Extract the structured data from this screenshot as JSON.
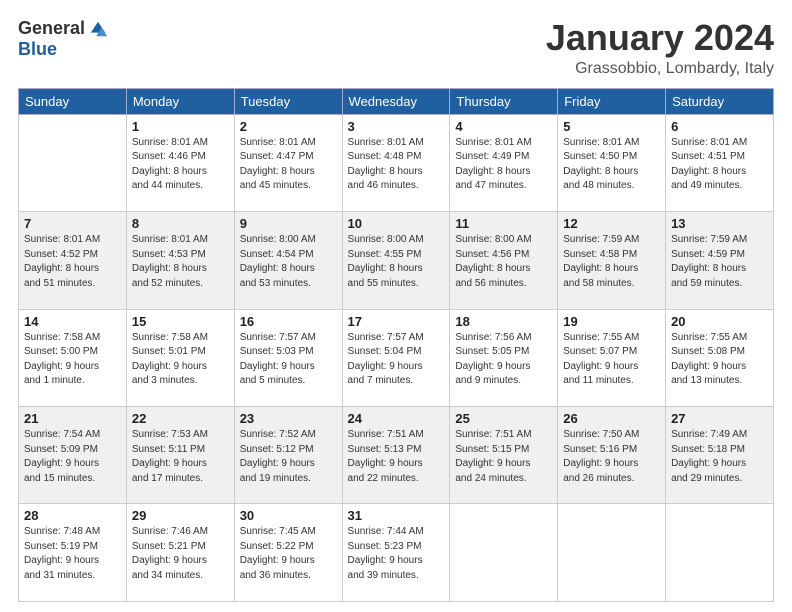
{
  "header": {
    "logo_general": "General",
    "logo_blue": "Blue",
    "month_title": "January 2024",
    "location": "Grassobbio, Lombardy, Italy"
  },
  "weekdays": [
    "Sunday",
    "Monday",
    "Tuesday",
    "Wednesday",
    "Thursday",
    "Friday",
    "Saturday"
  ],
  "weeks": [
    [
      {
        "date": "",
        "info": "",
        "shaded": false,
        "empty": true
      },
      {
        "date": "1",
        "info": "Sunrise: 8:01 AM\nSunset: 4:46 PM\nDaylight: 8 hours\nand 44 minutes.",
        "shaded": false
      },
      {
        "date": "2",
        "info": "Sunrise: 8:01 AM\nSunset: 4:47 PM\nDaylight: 8 hours\nand 45 minutes.",
        "shaded": false
      },
      {
        "date": "3",
        "info": "Sunrise: 8:01 AM\nSunset: 4:48 PM\nDaylight: 8 hours\nand 46 minutes.",
        "shaded": false
      },
      {
        "date": "4",
        "info": "Sunrise: 8:01 AM\nSunset: 4:49 PM\nDaylight: 8 hours\nand 47 minutes.",
        "shaded": false
      },
      {
        "date": "5",
        "info": "Sunrise: 8:01 AM\nSunset: 4:50 PM\nDaylight: 8 hours\nand 48 minutes.",
        "shaded": false
      },
      {
        "date": "6",
        "info": "Sunrise: 8:01 AM\nSunset: 4:51 PM\nDaylight: 8 hours\nand 49 minutes.",
        "shaded": false
      }
    ],
    [
      {
        "date": "7",
        "info": "Sunrise: 8:01 AM\nSunset: 4:52 PM\nDaylight: 8 hours\nand 51 minutes.",
        "shaded": true
      },
      {
        "date": "8",
        "info": "Sunrise: 8:01 AM\nSunset: 4:53 PM\nDaylight: 8 hours\nand 52 minutes.",
        "shaded": true
      },
      {
        "date": "9",
        "info": "Sunrise: 8:00 AM\nSunset: 4:54 PM\nDaylight: 8 hours\nand 53 minutes.",
        "shaded": true
      },
      {
        "date": "10",
        "info": "Sunrise: 8:00 AM\nSunset: 4:55 PM\nDaylight: 8 hours\nand 55 minutes.",
        "shaded": true
      },
      {
        "date": "11",
        "info": "Sunrise: 8:00 AM\nSunset: 4:56 PM\nDaylight: 8 hours\nand 56 minutes.",
        "shaded": true
      },
      {
        "date": "12",
        "info": "Sunrise: 7:59 AM\nSunset: 4:58 PM\nDaylight: 8 hours\nand 58 minutes.",
        "shaded": true
      },
      {
        "date": "13",
        "info": "Sunrise: 7:59 AM\nSunset: 4:59 PM\nDaylight: 8 hours\nand 59 minutes.",
        "shaded": true
      }
    ],
    [
      {
        "date": "14",
        "info": "Sunrise: 7:58 AM\nSunset: 5:00 PM\nDaylight: 9 hours\nand 1 minute.",
        "shaded": false
      },
      {
        "date": "15",
        "info": "Sunrise: 7:58 AM\nSunset: 5:01 PM\nDaylight: 9 hours\nand 3 minutes.",
        "shaded": false
      },
      {
        "date": "16",
        "info": "Sunrise: 7:57 AM\nSunset: 5:03 PM\nDaylight: 9 hours\nand 5 minutes.",
        "shaded": false
      },
      {
        "date": "17",
        "info": "Sunrise: 7:57 AM\nSunset: 5:04 PM\nDaylight: 9 hours\nand 7 minutes.",
        "shaded": false
      },
      {
        "date": "18",
        "info": "Sunrise: 7:56 AM\nSunset: 5:05 PM\nDaylight: 9 hours\nand 9 minutes.",
        "shaded": false
      },
      {
        "date": "19",
        "info": "Sunrise: 7:55 AM\nSunset: 5:07 PM\nDaylight: 9 hours\nand 11 minutes.",
        "shaded": false
      },
      {
        "date": "20",
        "info": "Sunrise: 7:55 AM\nSunset: 5:08 PM\nDaylight: 9 hours\nand 13 minutes.",
        "shaded": false
      }
    ],
    [
      {
        "date": "21",
        "info": "Sunrise: 7:54 AM\nSunset: 5:09 PM\nDaylight: 9 hours\nand 15 minutes.",
        "shaded": true
      },
      {
        "date": "22",
        "info": "Sunrise: 7:53 AM\nSunset: 5:11 PM\nDaylight: 9 hours\nand 17 minutes.",
        "shaded": true
      },
      {
        "date": "23",
        "info": "Sunrise: 7:52 AM\nSunset: 5:12 PM\nDaylight: 9 hours\nand 19 minutes.",
        "shaded": true
      },
      {
        "date": "24",
        "info": "Sunrise: 7:51 AM\nSunset: 5:13 PM\nDaylight: 9 hours\nand 22 minutes.",
        "shaded": true
      },
      {
        "date": "25",
        "info": "Sunrise: 7:51 AM\nSunset: 5:15 PM\nDaylight: 9 hours\nand 24 minutes.",
        "shaded": true
      },
      {
        "date": "26",
        "info": "Sunrise: 7:50 AM\nSunset: 5:16 PM\nDaylight: 9 hours\nand 26 minutes.",
        "shaded": true
      },
      {
        "date": "27",
        "info": "Sunrise: 7:49 AM\nSunset: 5:18 PM\nDaylight: 9 hours\nand 29 minutes.",
        "shaded": true
      }
    ],
    [
      {
        "date": "28",
        "info": "Sunrise: 7:48 AM\nSunset: 5:19 PM\nDaylight: 9 hours\nand 31 minutes.",
        "shaded": false
      },
      {
        "date": "29",
        "info": "Sunrise: 7:46 AM\nSunset: 5:21 PM\nDaylight: 9 hours\nand 34 minutes.",
        "shaded": false
      },
      {
        "date": "30",
        "info": "Sunrise: 7:45 AM\nSunset: 5:22 PM\nDaylight: 9 hours\nand 36 minutes.",
        "shaded": false
      },
      {
        "date": "31",
        "info": "Sunrise: 7:44 AM\nSunset: 5:23 PM\nDaylight: 9 hours\nand 39 minutes.",
        "shaded": false
      },
      {
        "date": "",
        "info": "",
        "shaded": false,
        "empty": true
      },
      {
        "date": "",
        "info": "",
        "shaded": false,
        "empty": true
      },
      {
        "date": "",
        "info": "",
        "shaded": false,
        "empty": true
      }
    ]
  ]
}
